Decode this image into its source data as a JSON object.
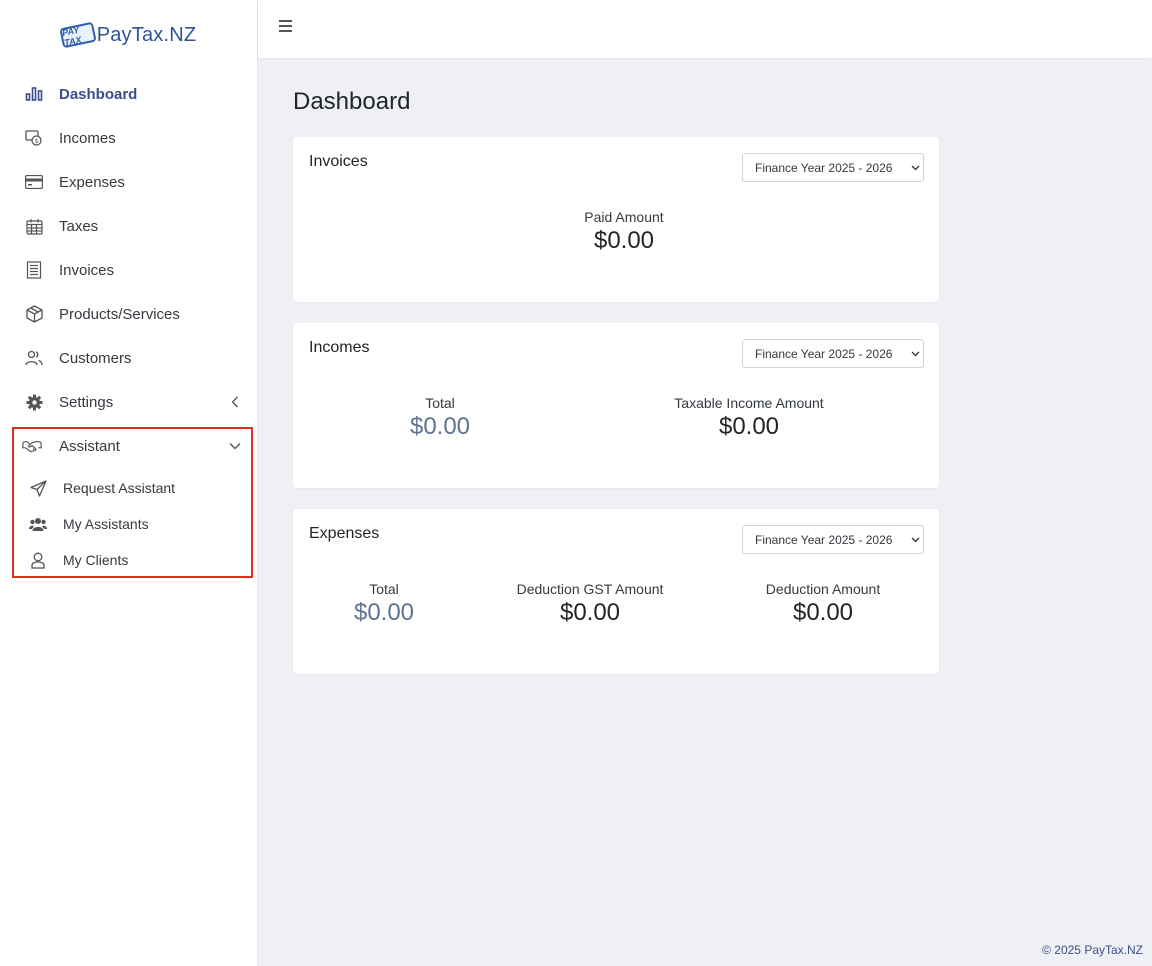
{
  "brand": {
    "logo_badge": "PAY TAX",
    "name": "PayTax.NZ"
  },
  "sidebar": {
    "items": [
      {
        "label": "Dashboard",
        "icon": "bar-chart-icon"
      },
      {
        "label": "Incomes",
        "icon": "money-icon"
      },
      {
        "label": "Expenses",
        "icon": "credit-card-icon"
      },
      {
        "label": "Taxes",
        "icon": "calendar-icon"
      },
      {
        "label": "Invoices",
        "icon": "receipt-icon"
      },
      {
        "label": "Products/Services",
        "icon": "box-icon"
      },
      {
        "label": "Customers",
        "icon": "users-icon"
      },
      {
        "label": "Settings",
        "icon": "gear-icon"
      },
      {
        "label": "Assistant",
        "icon": "handshake-icon"
      }
    ],
    "assistant_sub": [
      {
        "label": "Request Assistant",
        "icon": "paper-plane-icon"
      },
      {
        "label": "My Assistants",
        "icon": "user-group-icon"
      },
      {
        "label": "My Clients",
        "icon": "user-icon"
      }
    ]
  },
  "page": {
    "title": "Dashboard"
  },
  "cards": {
    "invoices": {
      "title": "Invoices",
      "year": "Finance Year 2025 - 2026",
      "paid_label": "Paid Amount",
      "paid_value": "$0.00"
    },
    "incomes": {
      "title": "Incomes",
      "year": "Finance Year 2025 - 2026",
      "total_label": "Total",
      "total_value": "$0.00",
      "taxable_label": "Taxable Income Amount",
      "taxable_value": "$0.00"
    },
    "expenses": {
      "title": "Expenses",
      "year": "Finance Year 2025 - 2026",
      "total_label": "Total",
      "total_value": "$0.00",
      "gst_label": "Deduction GST Amount",
      "gst_value": "$0.00",
      "deduction_label": "Deduction Amount",
      "deduction_value": "$0.00"
    }
  },
  "footer": {
    "text": "© 2025 PayTax.NZ"
  },
  "colors": {
    "accent": "#3b4e8c",
    "highlight_border": "#e0301e",
    "muted_value": "#5d7391"
  }
}
